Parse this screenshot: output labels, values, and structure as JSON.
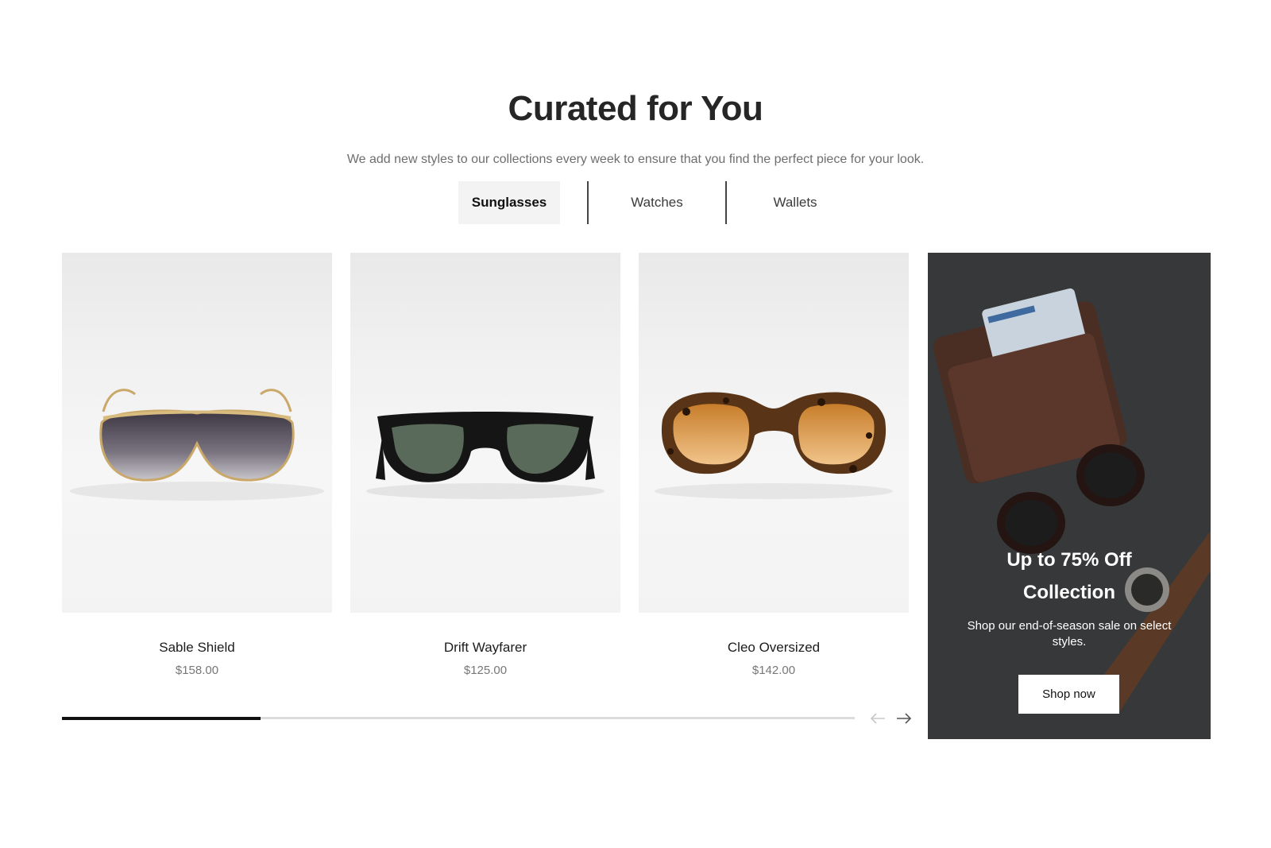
{
  "section": {
    "title": "Curated for You",
    "subtitle": "We add new styles to our collections every week to ensure that you find the perfect piece for your look."
  },
  "tabs": [
    {
      "label": "Sunglasses",
      "active": true
    },
    {
      "label": "Watches",
      "active": false
    },
    {
      "label": "Wallets",
      "active": false
    }
  ],
  "products": [
    {
      "name": "Sable Shield",
      "price": "$158.00"
    },
    {
      "name": "Drift Wayfarer",
      "price": "$125.00"
    },
    {
      "name": "Cleo Oversized",
      "price": "$142.00"
    }
  ],
  "promo": {
    "title_line1": "Up to 75% Off",
    "title_line2": "Collection",
    "description": "Shop our end-of-season sale on select styles.",
    "button_label": "Shop now"
  },
  "carousel": {
    "progress_fraction": 0.25,
    "prev_icon": "arrow-left-icon",
    "next_icon": "arrow-right-icon",
    "prev_disabled": true
  },
  "colors": {
    "accent": "#111111",
    "tab_active_bg": "#f3f3f3",
    "muted_text": "#6e6e6e"
  }
}
